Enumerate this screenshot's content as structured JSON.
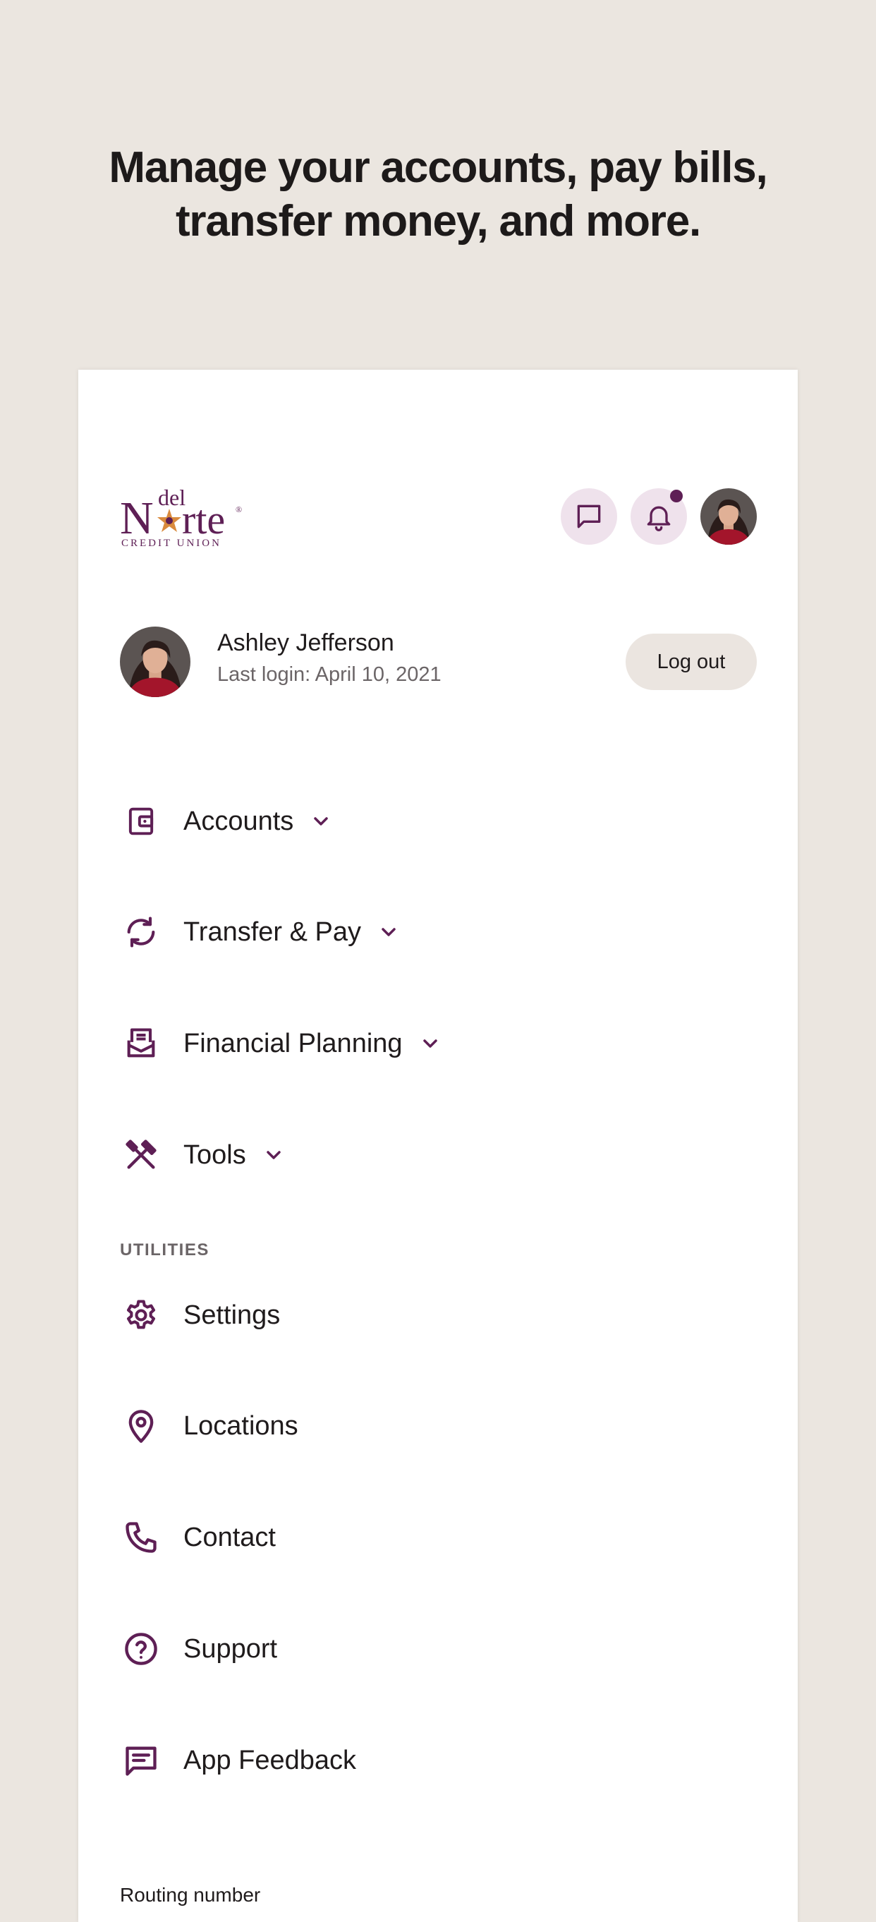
{
  "headline": {
    "line1": "Manage your accounts, pay bills,",
    "line2": "transfer money, and more."
  },
  "brand": {
    "logo_del": "del",
    "logo_n": "N",
    "logo_rte": "rte",
    "logo_sub": "CREDIT UNION",
    "logo_registered": "®",
    "primary_color": "#5e1f55",
    "star_color": "#d98a3d"
  },
  "header": {
    "icons": [
      "message-icon",
      "bell-icon",
      "avatar"
    ]
  },
  "user": {
    "name": "Ashley Jefferson",
    "last_login": "Last login: April 10, 2021",
    "logout_label": "Log out"
  },
  "nav": {
    "items": [
      {
        "label": "Accounts",
        "icon": "wallet-icon"
      },
      {
        "label": "Transfer & Pay",
        "icon": "refresh-icon"
      },
      {
        "label": "Financial Planning",
        "icon": "inbox-icon"
      },
      {
        "label": "Tools",
        "icon": "tools-icon"
      }
    ]
  },
  "utilities": {
    "section_label": "UTILITIES",
    "items": [
      {
        "label": "Settings",
        "icon": "gear-icon"
      },
      {
        "label": "Locations",
        "icon": "location-pin-icon"
      },
      {
        "label": "Contact",
        "icon": "phone-icon"
      },
      {
        "label": "Support",
        "icon": "help-circle-icon"
      },
      {
        "label": "App Feedback",
        "icon": "feedback-icon"
      }
    ]
  },
  "footer": {
    "routing_label": "Routing number"
  }
}
